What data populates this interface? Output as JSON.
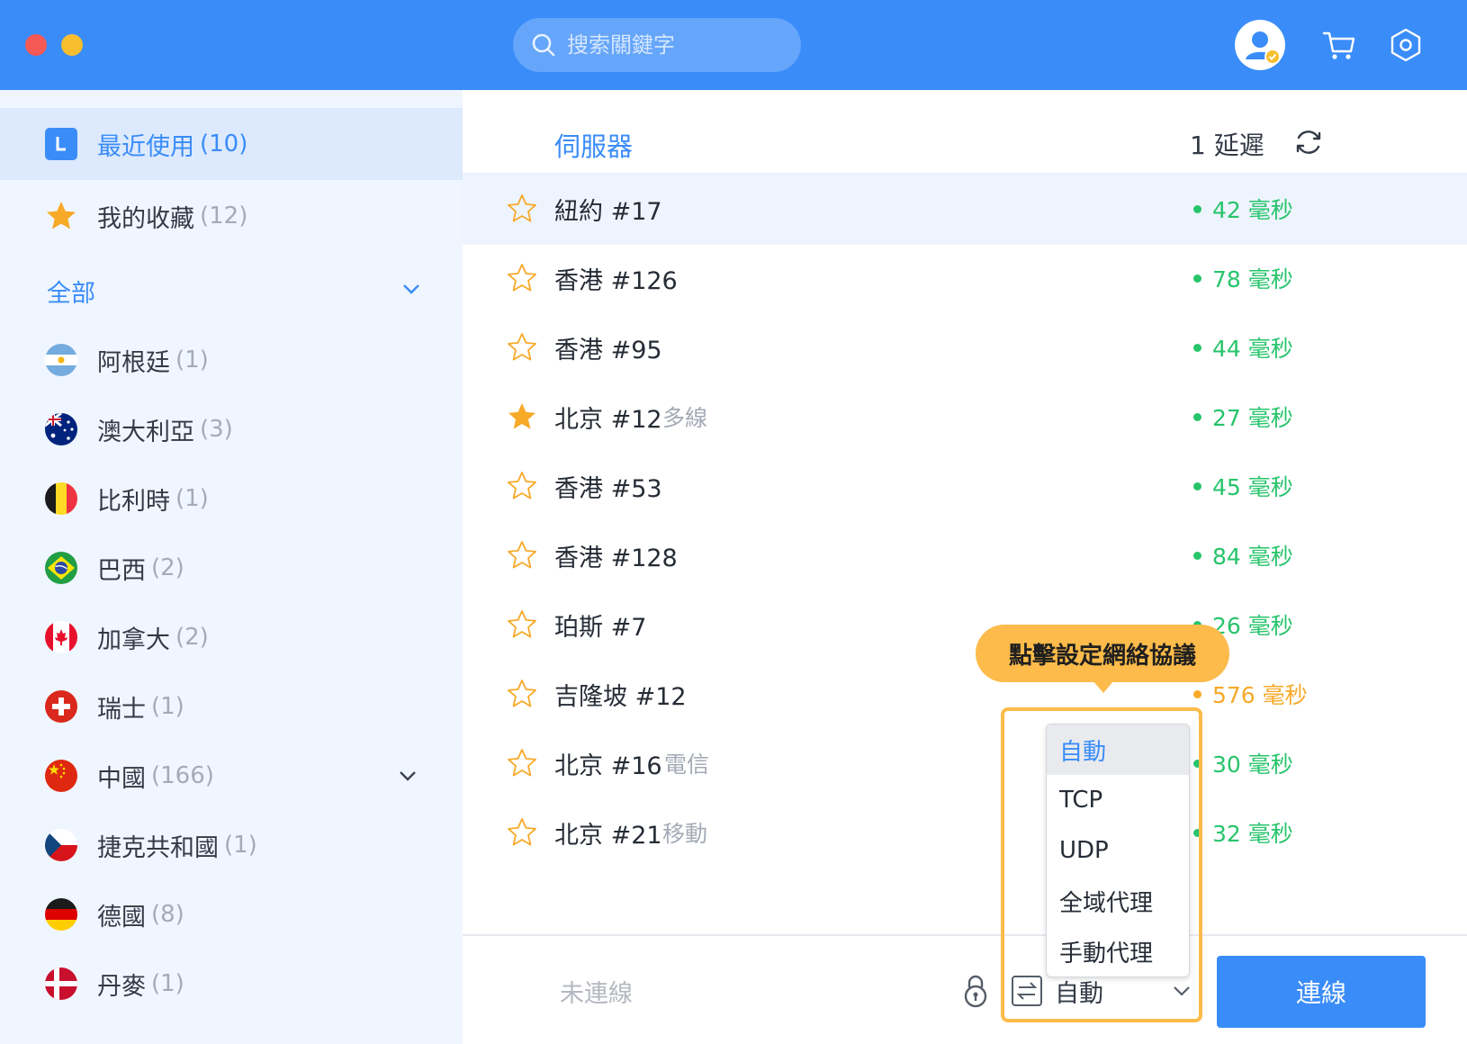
{
  "titlebar": {
    "search_placeholder": "搜索關鍵字",
    "search_icon": "search-icon",
    "avatar_icon": "user-avatar-icon",
    "cart_icon": "cart-icon",
    "settings_icon": "settings-hexagon-icon"
  },
  "sidebar": {
    "recent": {
      "label": "最近使用",
      "count": "(10)",
      "icon": "recent-l-icon"
    },
    "favorites": {
      "label": "我的收藏",
      "count": "(12)",
      "icon": "star-icon"
    },
    "all_label": "全部",
    "countries": [
      {
        "name": "阿根廷",
        "count": "(1)",
        "flag": "argentina-flag"
      },
      {
        "name": "澳大利亞",
        "count": "(3)",
        "flag": "australia-flag"
      },
      {
        "name": "比利時",
        "count": "(1)",
        "flag": "belgium-flag"
      },
      {
        "name": "巴西",
        "count": "(2)",
        "flag": "brazil-flag"
      },
      {
        "name": "加拿大",
        "count": "(2)",
        "flag": "canada-flag"
      },
      {
        "name": "瑞士",
        "count": "(1)",
        "flag": "switzerland-flag"
      },
      {
        "name": "中國",
        "count": "(166)",
        "flag": "china-flag"
      },
      {
        "name": "捷克共和國",
        "count": "(1)",
        "flag": "czech-flag"
      },
      {
        "name": "德國",
        "count": "(8)",
        "flag": "germany-flag"
      },
      {
        "name": "丹麥",
        "count": "(1)",
        "flag": "denmark-flag"
      }
    ]
  },
  "main": {
    "header_server": "伺服器",
    "header_latency": "1 延遲",
    "servers": [
      {
        "name": "紐約 #17",
        "tag": "",
        "latency": "42 毫秒",
        "favorite": false,
        "status": "green"
      },
      {
        "name": "香港 #126",
        "tag": "",
        "latency": "78 毫秒",
        "favorite": false,
        "status": "green"
      },
      {
        "name": "香港 #95",
        "tag": "",
        "latency": "44 毫秒",
        "favorite": false,
        "status": "green"
      },
      {
        "name": "北京 #12",
        "tag": "多線",
        "latency": "27 毫秒",
        "favorite": true,
        "status": "green"
      },
      {
        "name": "香港 #53",
        "tag": "",
        "latency": "45 毫秒",
        "favorite": false,
        "status": "green"
      },
      {
        "name": "香港 #128",
        "tag": "",
        "latency": "84 毫秒",
        "favorite": false,
        "status": "green"
      },
      {
        "name": "珀斯 #7",
        "tag": "",
        "latency": "26 毫秒",
        "favorite": false,
        "status": "green"
      },
      {
        "name": "吉隆坡 #12",
        "tag": "",
        "latency": "576 毫秒",
        "favorite": false,
        "status": "orange"
      },
      {
        "name": "北京 #16",
        "tag": "電信",
        "latency": "30 毫秒",
        "favorite": false,
        "status": "green"
      },
      {
        "name": "北京 #21",
        "tag": "移動",
        "latency": "32 毫秒",
        "favorite": false,
        "status": "green"
      }
    ],
    "footer": {
      "status": "未連線",
      "protocol_value": "自動",
      "connect_label": "連線"
    },
    "tooltip": "點擊設定網絡協議",
    "protocol_options": [
      "自動",
      "TCP",
      "UDP",
      "全域代理",
      "手動代理"
    ],
    "protocol_selected": "自動"
  },
  "colors": {
    "accent": "#3a8cf9",
    "latency_good": "#27c46b",
    "latency_slow": "#f7a928",
    "tooltip": "#fcbb4a",
    "favorite_star": "#f7a928"
  }
}
